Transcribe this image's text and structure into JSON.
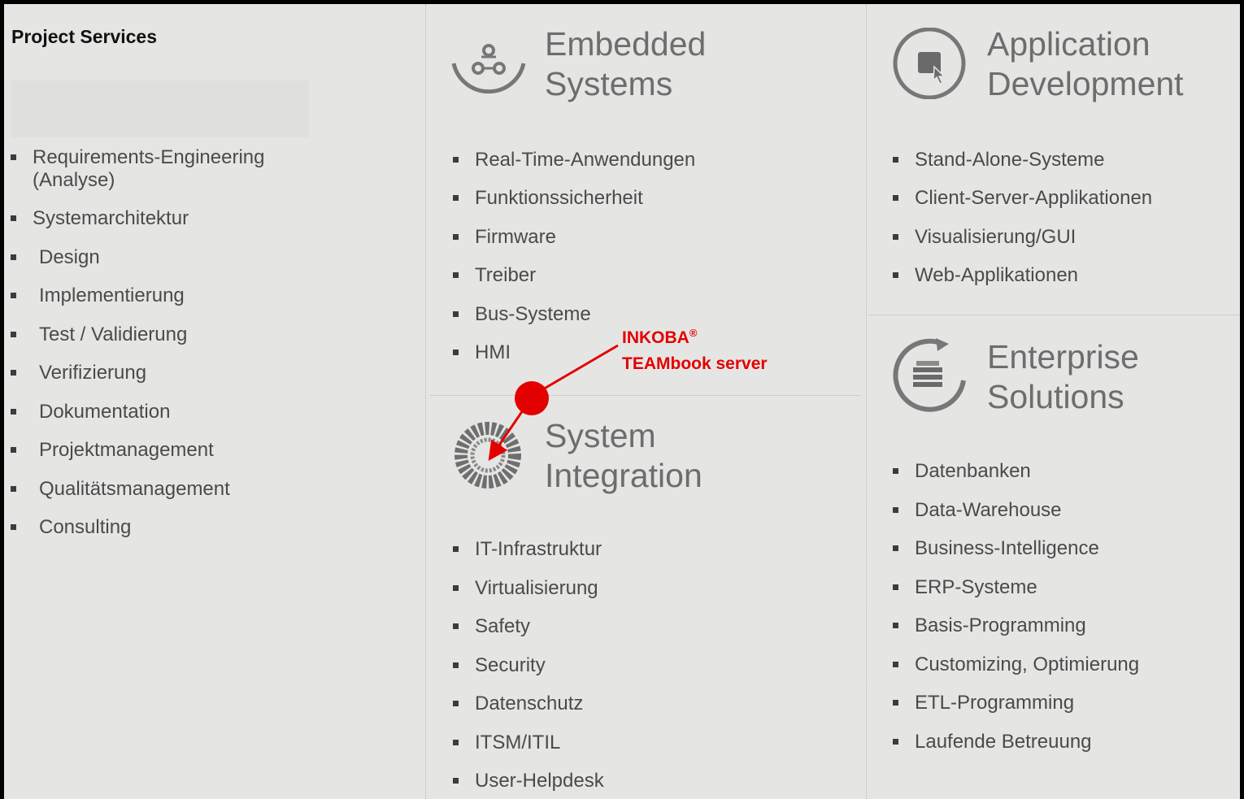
{
  "project_services": {
    "title": "Project Services",
    "items": [
      "Requirements-Engineering (Analyse)",
      "Systemarchitektur",
      "Design",
      "Implementierung",
      "Test / Validierung",
      "Verifizierung",
      "Dokumentation",
      "Projektmanagement",
      "Qualitätsmanagement",
      "Consulting"
    ]
  },
  "embedded": {
    "title_line1": "Embedded",
    "title_line2": "Systems",
    "icon": "embedded-systems-icon",
    "items": [
      "Real-Time-Anwendungen",
      "Funktionssicherheit",
      "Firmware",
      "Treiber",
      "Bus-Systeme",
      "HMI"
    ]
  },
  "system_integration": {
    "title_line1": "System",
    "title_line2": "Integration",
    "icon": "system-integration-icon",
    "items": [
      "IT-Infrastruktur",
      "Virtualisierung",
      "Safety",
      "Security",
      "Datenschutz",
      "ITSM/ITIL",
      "User-Helpdesk"
    ]
  },
  "application": {
    "title_line1": "Application",
    "title_line2": "Development",
    "icon": "application-development-icon",
    "items": [
      "Stand-Alone-Systeme",
      "Client-Server-Applikationen",
      "Visualisierung/GUI",
      "Web-Applikationen"
    ]
  },
  "enterprise": {
    "title_line1": "Enterprise",
    "title_line2": "Solutions",
    "icon": "enterprise-solutions-icon",
    "items": [
      "Datenbanken",
      "Data-Warehouse",
      "Business-Intelligence",
      "ERP-Systeme",
      "Basis-Programming",
      "Customizing, Optimierung",
      "ETL-Programming",
      "Laufende Betreuung"
    ]
  },
  "annotation": {
    "brand": "INKOBA",
    "registered_mark": "®",
    "product": "TEAMbook server",
    "color": "#e30000"
  },
  "colors": {
    "background": "#e5e6e4",
    "heading": "#6d6d6d",
    "text": "#4a4a4a",
    "annotation": "#e30000"
  }
}
